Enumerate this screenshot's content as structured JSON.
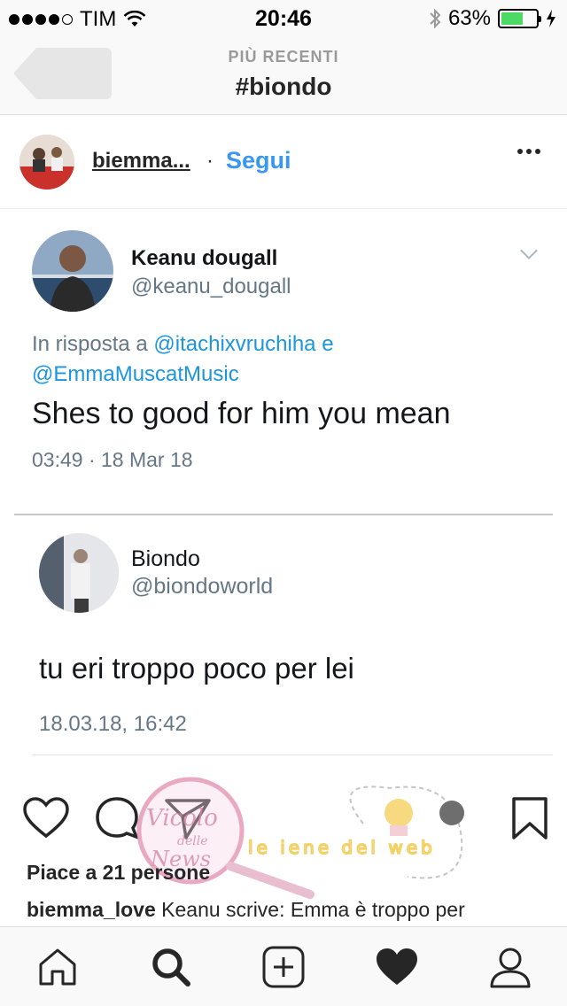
{
  "status_bar": {
    "carrier": "TIM",
    "time": "20:46",
    "battery_percent": "63%",
    "battery_level": 0.63,
    "signal_icon": "signal-dots-icon",
    "wifi_icon": "wifi-icon",
    "bluetooth_icon": "bluetooth-icon",
    "charging_icon": "bolt-icon"
  },
  "nav": {
    "subtitle": "PIÙ RECENTI",
    "title": "#biondo",
    "back_icon": "back-button"
  },
  "post": {
    "username": "biemma...",
    "separator": "·",
    "follow_label": "Segui",
    "more_icon": "more-dots-icon"
  },
  "tweet1": {
    "name": "Keanu dougall",
    "handle": "@keanu_dougall",
    "reply_prefix": "In risposta a",
    "reply_user1": "@itachixvruchiha",
    "reply_and": "e",
    "reply_user2": "@EmmaMuscatMusic",
    "text": "Shes to good for him you mean",
    "date": "03:49 · 18 Mar 18"
  },
  "tweet2": {
    "name": "Biondo",
    "handle": "@biondoworld",
    "text": "tu eri troppo poco per lei",
    "date": "18.03.18, 16:42"
  },
  "actions": {
    "like_icon": "heart-outline-icon",
    "comment_icon": "comment-icon",
    "share_icon": "send-icon",
    "save_icon": "bookmark-icon"
  },
  "likes_text": "Piace a 21 persone",
  "caption": {
    "username": "biemma_love",
    "text": "Keanu scrive: Emma è troppo per"
  },
  "watermark": {
    "text1": "Vicolo delle News",
    "text2": "le iene del web"
  },
  "tabbar": {
    "items": [
      "home-icon",
      "search-icon",
      "add-post-icon",
      "activity-heart-icon",
      "profile-icon"
    ]
  }
}
